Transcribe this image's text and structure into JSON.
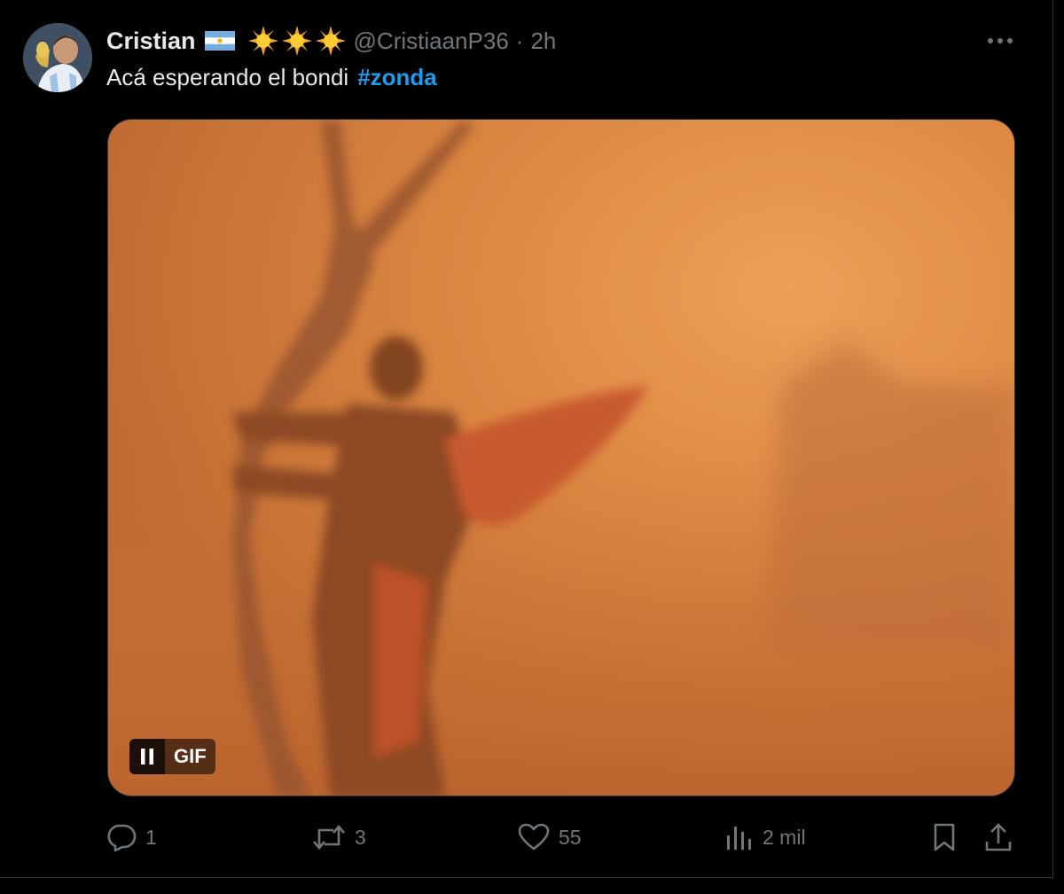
{
  "tweet": {
    "author": {
      "display_name": "Cristian",
      "flag_icon": "argentina-flag-icon",
      "badges": [
        "sun-emoji-icon",
        "sun-emoji-icon",
        "sun-emoji-icon"
      ],
      "handle": "@CristiaanP36",
      "separator": "·",
      "time": "2h"
    },
    "text": "Acá esperando el bondi",
    "hashtag": "#zonda",
    "media": {
      "type": "GIF",
      "label": "GIF",
      "playback": "playing"
    },
    "actions": {
      "reply_count": "1",
      "retweet_count": "3",
      "like_count": "55",
      "views_count": "2 mil"
    }
  },
  "colors": {
    "background": "#000000",
    "text_primary": "#e7e9ea",
    "text_secondary": "#71767b",
    "link": "#1d9bf0",
    "border": "#2f3336"
  }
}
